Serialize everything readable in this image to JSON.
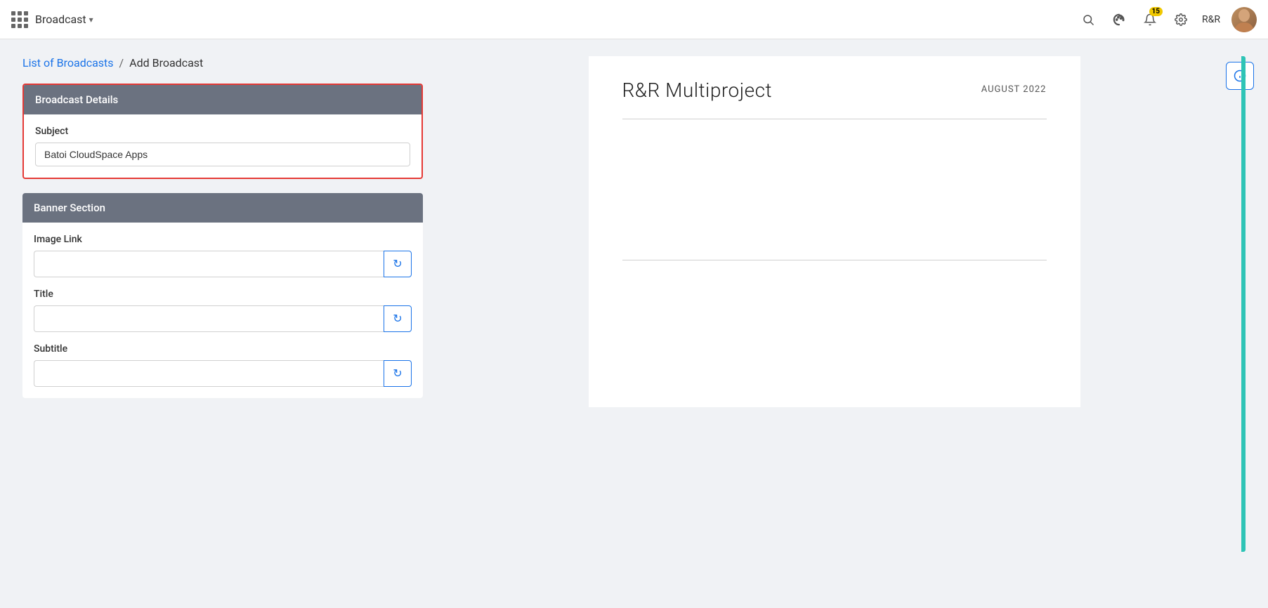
{
  "topnav": {
    "app_title": "Broadcast",
    "app_title_chevron": "▾",
    "notification_count": "15",
    "user_label": "R&R",
    "icons": {
      "search": "🔍",
      "camera": "🎨",
      "notification": "🔔",
      "settings": "⚙",
      "grid": "grid"
    }
  },
  "breadcrumb": {
    "list_link": "List of Broadcasts",
    "separator": "/",
    "current": "Add Broadcast"
  },
  "broadcast_details": {
    "header": "Broadcast Details",
    "subject_label": "Subject",
    "subject_value": "Batoi CloudSpace Apps"
  },
  "banner_section": {
    "header": "Banner Section",
    "image_link_label": "Image Link",
    "image_link_value": "",
    "title_label": "Title",
    "title_value": "",
    "subtitle_label": "Subtitle",
    "subtitle_value": "",
    "refresh_icon": "↻"
  },
  "preview": {
    "company_name": "R&R Multiproject",
    "date": "AUGUST 2022"
  },
  "help_btn_icon": "ℹ"
}
